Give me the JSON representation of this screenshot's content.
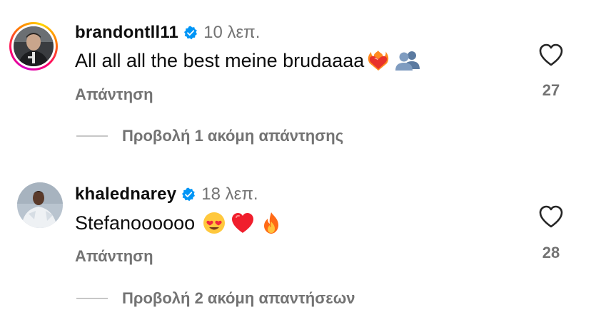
{
  "comments": [
    {
      "username": "brandontll11",
      "time": "10 λεπ.",
      "text": "All all all the best meine brudaaaa",
      "emojis": [
        "heart-on-fire",
        "busts-in-silhouette"
      ],
      "reply_label": "Απάντηση",
      "likes": "27",
      "view_replies": "Προβολή 1 ακόμη απάντησης",
      "has_story_ring": true
    },
    {
      "username": "khalednarey",
      "time": "18 λεπ.",
      "text": "Stefanoooooo",
      "emojis": [
        "smiling-face-with-heart-eyes",
        "red-heart",
        "fire"
      ],
      "reply_label": "Απάντηση",
      "likes": "28",
      "view_replies": "Προβολή 2 ακόμη απαντήσεων",
      "has_story_ring": false
    }
  ],
  "colors": {
    "verified_blue": "#0095f6",
    "secondary_text": "#737373",
    "divider": "#c7c7c7"
  }
}
